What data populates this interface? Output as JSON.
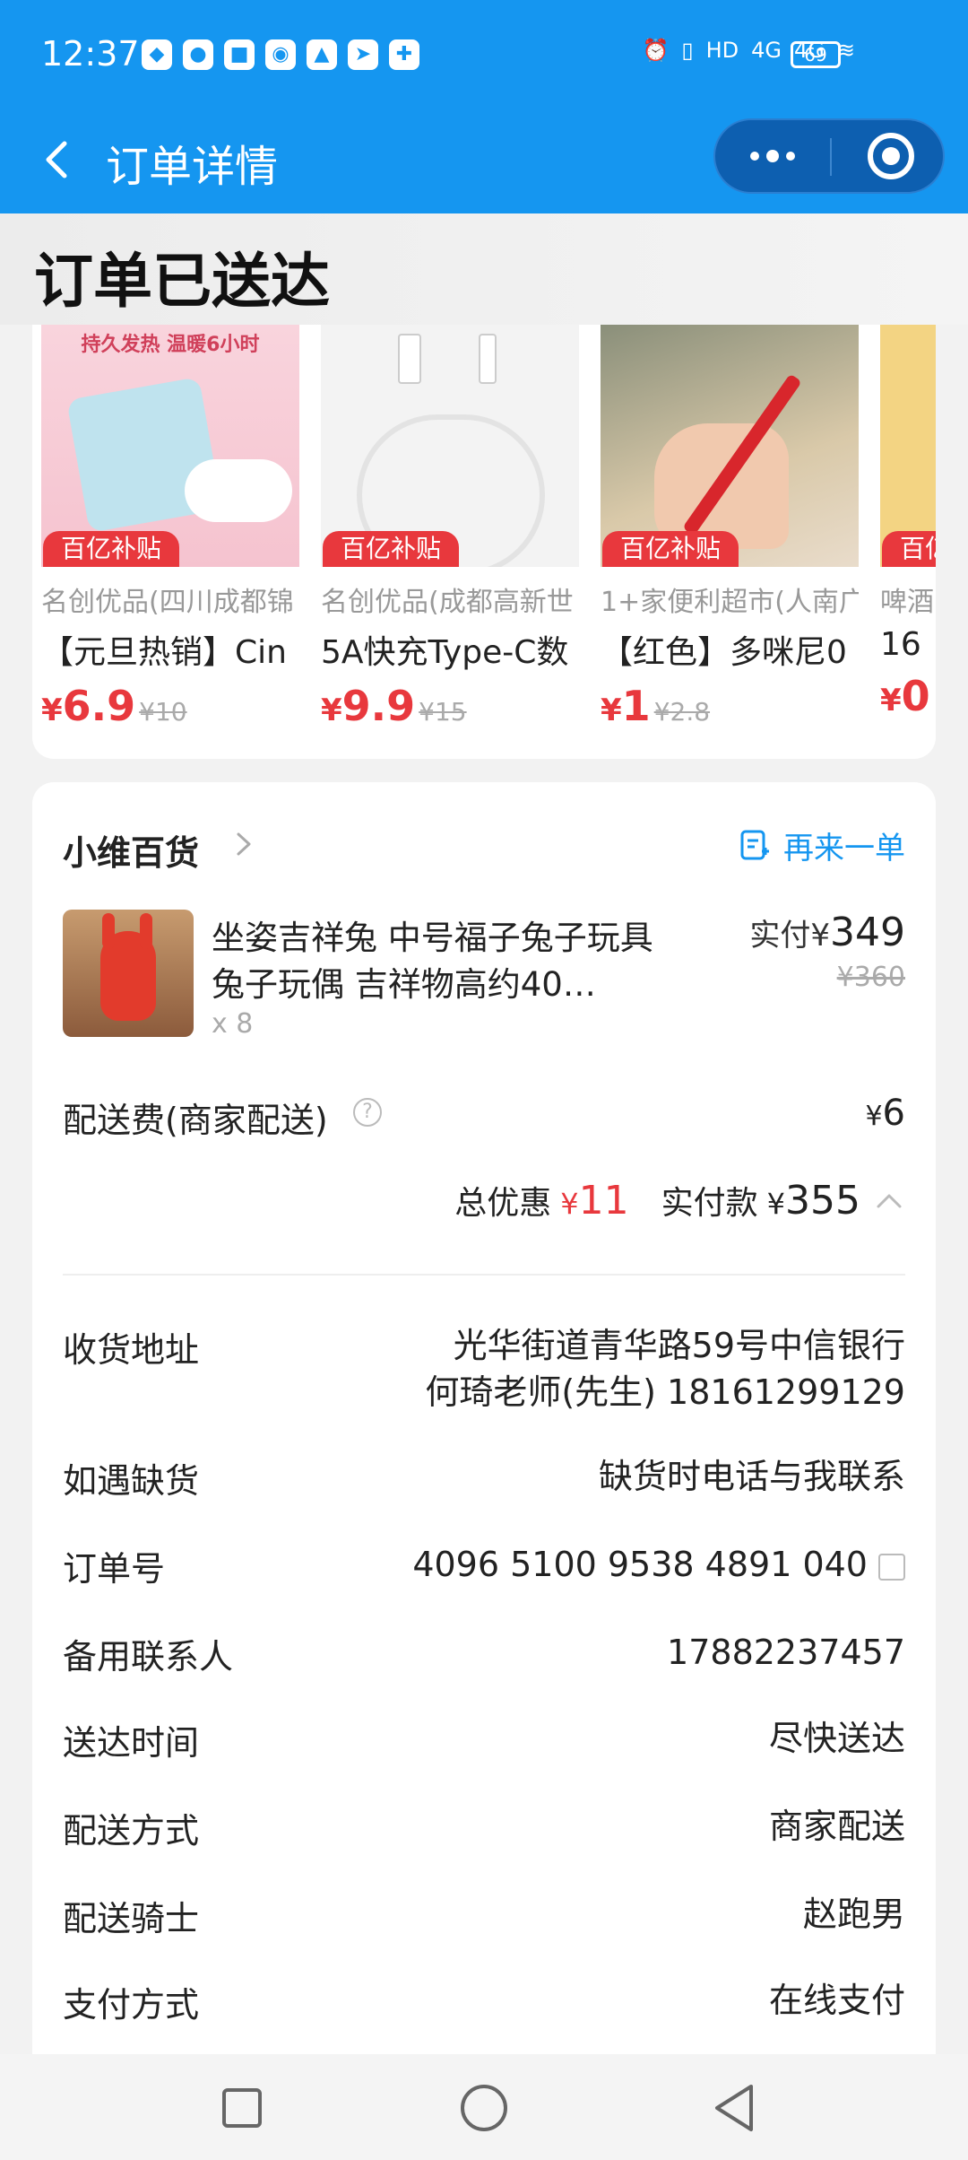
{
  "status_bar": {
    "time": "12:37",
    "signal1": "4G",
    "signal2": "4G",
    "battery": "69"
  },
  "titlebar": {
    "title": "订单详情"
  },
  "order_status": "订单已送达",
  "recommendations": [
    {
      "badge": "百亿补贴",
      "store": "名创优品(四川成都锦",
      "name": "【元旦热销】Cin",
      "price": "6.9",
      "orig": "¥10",
      "img_text": "持久发热 温暖6小时"
    },
    {
      "badge": "百亿补贴",
      "store": "名创优品(成都高新世",
      "name": "5A快充Type-C数",
      "price": "9.9",
      "orig": "¥15"
    },
    {
      "badge": "百亿补贴",
      "store": "1+家便利超市(人南广",
      "name": "【红色】多咪尼0",
      "price": "1",
      "orig": "¥2.8"
    },
    {
      "badge": "百亿补贴",
      "store": "啤酒",
      "name": "16",
      "price": "0",
      "orig": ""
    }
  ],
  "currency": "¥",
  "shop": {
    "name": "小维百货",
    "reorder_label": "再来一单"
  },
  "goods": {
    "name": "坐姿吉祥兔 中号福子兔子玩具 兔子玩偶 吉祥物高约40…",
    "qty": "x 8",
    "paid_label": "实付",
    "paid_value": "349",
    "orig_price": "¥360"
  },
  "fee": {
    "label": "配送费(商家配送)",
    "value": "6"
  },
  "totals": {
    "discount_label": "总优惠",
    "discount_value": "11",
    "paid_label": "实付款",
    "paid_value": "355"
  },
  "info": {
    "address_label": "收货地址",
    "address_line1": "光华街道青华路59号中信银行",
    "address_line2": "何琦老师(先生) 18161299129",
    "stockout_label": "如遇缺货",
    "stockout_value": "缺货时电话与我联系",
    "order_no_label": "订单号",
    "order_no_value": "4096 5100 9538 4891 040",
    "backup_contact_label": "备用联系人",
    "backup_contact_value": "17882237457",
    "delivery_time_label": "送达时间",
    "delivery_time_value": "尽快送达",
    "delivery_method_label": "配送方式",
    "delivery_method_value": "商家配送",
    "rider_label": "配送骑士",
    "rider_value": "赵跑男",
    "payment_label": "支付方式",
    "payment_value": "在线支付"
  },
  "colors": {
    "primary": "#1596f0",
    "accent_red": "#e8383d",
    "background": "#f2f2f2"
  }
}
